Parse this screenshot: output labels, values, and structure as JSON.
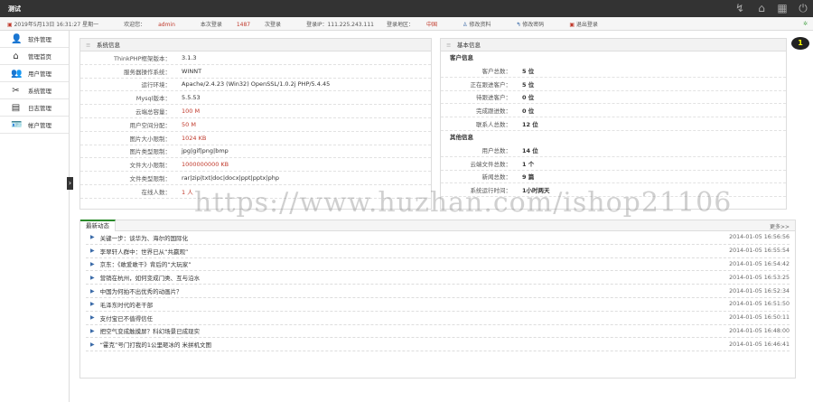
{
  "app": {
    "title": "测试"
  },
  "topbar": {
    "icons": [
      "refresh-icon",
      "home-icon",
      "grid-icon",
      "power-icon"
    ]
  },
  "infobar": {
    "datetime": "2019年5月13日 16:31:27 星期一",
    "user_label": "欢迎您：",
    "user": "admin",
    "login_label": "本次登录",
    "login_count": "1487",
    "login_suffix": "次登录",
    "ip": "登录IP：111.225.243.111",
    "area_label": "登录地区：",
    "area": "中国",
    "edit_profile": "修改资料",
    "change_password": "修改密码",
    "logout": "退出登录"
  },
  "sidebar": {
    "items": [
      {
        "label": "软件管理",
        "icon": "👤"
      },
      {
        "label": "管理首页",
        "icon": "⌂"
      },
      {
        "label": "用户管理",
        "icon": "👥"
      },
      {
        "label": "系统管理",
        "icon": "✂"
      },
      {
        "label": "日志管理",
        "icon": "▤"
      },
      {
        "label": "帐户管理",
        "icon": "🪪"
      }
    ]
  },
  "system": {
    "title": "系统信息",
    "rows": [
      {
        "k": "ThinkPHP框架版本：",
        "v": "3.1.3",
        "red": false
      },
      {
        "k": "服务器操作系统：",
        "v": "WINNT",
        "red": false
      },
      {
        "k": "运行环境：",
        "v": "Apache/2.4.23 (Win32) OpenSSL/1.0.2j PHP/5.4.45",
        "red": false
      },
      {
        "k": "Mysql版本：",
        "v": "5.5.53",
        "red": false
      },
      {
        "k": "云端总容量：",
        "v": "100 M",
        "red": true
      },
      {
        "k": "用户空间分配：",
        "v": "50 M",
        "red": true
      },
      {
        "k": "图片大小限制：",
        "v": "1024 KB",
        "red": true
      },
      {
        "k": "图片类型限制：",
        "v": "jpg|gif|png|bmp",
        "red": false
      },
      {
        "k": "文件大小限制：",
        "v": "1000000000 KB",
        "red": true
      },
      {
        "k": "文件类型限制：",
        "v": "rar|zip|txt|doc|docx|ppt|pptx|php",
        "red": false
      },
      {
        "k": "在线人数：",
        "v": "1 人",
        "red": true
      }
    ]
  },
  "basic": {
    "title": "基本信息",
    "sections": [
      {
        "title": "客户信息",
        "rows": [
          {
            "k": "客户总数：",
            "v": "5 位"
          },
          {
            "k": "正在跟进客户：",
            "v": "5 位"
          },
          {
            "k": "待跟进客户：",
            "v": "0 位"
          },
          {
            "k": "完成跟进数：",
            "v": "0 位"
          },
          {
            "k": "联系人总数：",
            "v": "12 位"
          }
        ]
      },
      {
        "title": "其他信息",
        "rows": [
          {
            "k": "用户总数：",
            "v": "14 位"
          },
          {
            "k": "云端文件总数：",
            "v": "1 个"
          },
          {
            "k": "新闻总数：",
            "v": "9 篇"
          },
          {
            "k": "系统运行时间：",
            "v": "1小时两天"
          }
        ]
      }
    ]
  },
  "news": {
    "tab": "最新动态",
    "more": "更多>>",
    "items": [
      {
        "t": "关键一步：谈华为、海尔的国际化",
        "d": "2014-01-05 16:56:56"
      },
      {
        "t": "李翠轩人群中：世界已从“共赢观”",
        "d": "2014-01-05 16:55:54"
      },
      {
        "t": "京东：《敢爱敢干》背后的“大玩家”",
        "d": "2014-01-05 16:54:42"
      },
      {
        "t": "营销在杭州，如何变成门类、互与沿水",
        "d": "2014-01-05 16:53:25"
      },
      {
        "t": "中国为何拍不出优秀的动画片？",
        "d": "2014-01-05 16:52:34"
      },
      {
        "t": "毛泽东时代的老干部",
        "d": "2014-01-05 16:51:50"
      },
      {
        "t": "支付宝已不值得信任",
        "d": "2014-01-05 16:50:11"
      },
      {
        "t": "把空气变成触摸屏？科幻场景已成现实",
        "d": "2014-01-05 16:48:00"
      },
      {
        "t": "“霍克”号门打我的1公里砸冰的 米拼机文图",
        "d": "2014-01-05 16:46:41"
      }
    ]
  },
  "notification": {
    "count": "1"
  },
  "watermark": "https://www.huzhan.com/ishop21106"
}
